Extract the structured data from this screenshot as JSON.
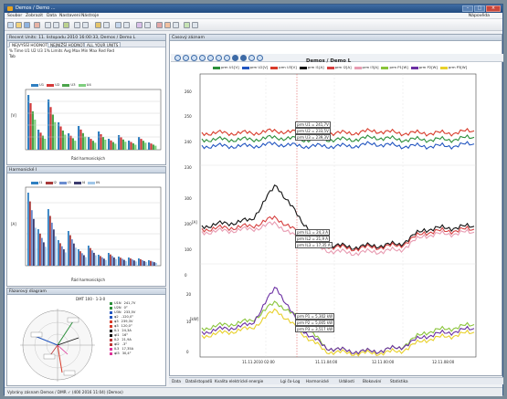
{
  "window": {
    "title": "Demos / Demo ...",
    "help_menu": "Nápověda",
    "menu": [
      "Soubor",
      "Zobrazit",
      "Data",
      "Nastavení",
      "Nástroje"
    ]
  },
  "left_panel": {
    "header": "Recent Units: 11. listopadu 2010 16:00:33, Demos / Demo L",
    "tabs": [
      "NEJVYŠŠÍ HODNOTY",
      "NEJNIŽŠÍ HODNOTY",
      "ALL YOUR UNITS"
    ],
    "options": [
      "% Time",
      "U1",
      "U2",
      "U3",
      "1%",
      "Limits",
      "Avg",
      "Max",
      "Min",
      "Max",
      "Red",
      "Red"
    ],
    "options_text": "% Time  U1  U2  U3  1%  Limits  Avg  Max  Min  Max  Red  Red",
    "harmonics_u": {
      "header": "Tab",
      "legend": [
        "U1",
        "U2",
        "U3",
        "U4"
      ],
      "ylabel": "[V]",
      "xlabel": "Řád harmonických",
      "y_ticks": [
        "100",
        "80",
        "60",
        "40",
        "20",
        "0"
      ],
      "x_ticks": [
        "1",
        "3",
        "5",
        "7",
        "9",
        "11",
        "13",
        "15",
        "17",
        "19",
        "21",
        "23",
        "25"
      ]
    },
    "harmonics_i": {
      "header": "Harmonické I",
      "legend": [
        "I1",
        "I2",
        "I3",
        "I4",
        "IN"
      ],
      "ylabel": "[A]",
      "xlabel": "Řád harmonických",
      "y_ticks": [
        "100",
        "80",
        "60",
        "40",
        "20",
        "0"
      ],
      "x_ticks": [
        "1",
        "3",
        "5",
        "7",
        "9",
        "11",
        "13",
        "15",
        "17",
        "19",
        "21",
        "23",
        "25"
      ]
    },
    "phasor": {
      "header": "Fázorový diagram",
      "caption": "DMT 100 · 1-3-0"
    }
  },
  "right_panel": {
    "header": "Časový záznam",
    "chart_title": "Demos / Demo L",
    "bottom_tabs": [
      "Data",
      "Datalistopadů",
      "Kvalita elektrické energie",
      "Lgi čo-Log",
      "Harmonické",
      "Události",
      "Blokování",
      "Statistika"
    ],
    "status_bar": "Vybrány zásnam Demos / DMR ✓ (400 2016 11:04) (Demos)"
  },
  "chart_data": {
    "type": "line",
    "title": "Demos / Demo L",
    "x_ticks": [
      "11.11.2010 02:00",
      "11.11.04:00",
      "12.11.00:00",
      "12.11.08:00"
    ],
    "voltage": {
      "legend": [
        "prm U1[V]",
        "prm U2[V]",
        "prm U3[V]"
      ],
      "annotations": [
        "prm U1 = 241,7V",
        "prm U2 = 233,5V",
        "prm U3 = 239,3V"
      ],
      "y_ticks_left": [
        "260",
        "250",
        "240",
        "230"
      ],
      "y_ticks_right": [
        "40",
        "30",
        "20",
        "10",
        "0"
      ],
      "series": [
        {
          "name": "prm U1[V]",
          "color": "#2b8f3a",
          "values": [
            236,
            236,
            236,
            237,
            236,
            236,
            236,
            237,
            236,
            236,
            236,
            237
          ]
        },
        {
          "name": "prm U2[V]",
          "color": "#2255c0",
          "values": [
            233,
            233,
            233,
            234,
            233,
            233,
            233,
            234,
            233,
            233,
            233,
            234
          ]
        },
        {
          "name": "prm U3[V]",
          "color": "#d83b2a",
          "values": [
            239,
            239,
            239,
            240,
            239,
            239,
            239,
            240,
            239,
            239,
            239,
            240
          ]
        }
      ]
    },
    "current": {
      "legend": [
        "prm I1[A]",
        "prm I2[A]",
        "prm I3[A]"
      ],
      "annotations": [
        "prm IL1 = 24,3 A",
        "prm IL2 = 21,9 A",
        "prm IL3 = 17,35 A"
      ],
      "ylabel": "[A]",
      "y_ticks": [
        "300",
        "200",
        "100",
        "0"
      ],
      "series": [
        {
          "name": "prm I1[A]",
          "color": "#111111",
          "values": [
            120,
            130,
            140,
            260,
            140,
            60,
            50,
            55,
            60,
            110,
            115,
            120
          ]
        },
        {
          "name": "prm I2[A]",
          "color": "#d64040",
          "values": [
            110,
            115,
            120,
            150,
            90,
            55,
            45,
            50,
            55,
            100,
            105,
            110
          ]
        },
        {
          "name": "prm I3[A]",
          "color": "#e89cb2",
          "values": [
            100,
            105,
            110,
            130,
            70,
            40,
            30,
            35,
            40,
            90,
            95,
            100
          ]
        }
      ]
    },
    "power": {
      "legend": [
        "prm P1[W]",
        "prm P2[W]",
        "prm P3[W]"
      ],
      "annotations": [
        "prm P1 = 5,302 kW",
        "prm P2 = 5,005 kW",
        "prm P3 = 3,517 kW"
      ],
      "ylabel": "[kW]",
      "y_ticks": [
        "20",
        "10",
        "0"
      ],
      "series": [
        {
          "name": "prm P1[W]",
          "color": "#8ac43a",
          "values": [
            7,
            8,
            9,
            14,
            9,
            2,
            1,
            1,
            2,
            6,
            7,
            8
          ]
        },
        {
          "name": "prm P2[W]",
          "color": "#6b2fa3",
          "values": [
            6,
            7,
            8,
            18,
            7,
            2,
            1,
            1,
            2,
            5,
            6,
            7
          ]
        },
        {
          "name": "prm P3[W]",
          "color": "#e8d02a",
          "values": [
            5,
            6,
            7,
            12,
            6,
            1,
            0.5,
            0.5,
            1,
            4,
            5,
            6
          ]
        }
      ]
    }
  }
}
